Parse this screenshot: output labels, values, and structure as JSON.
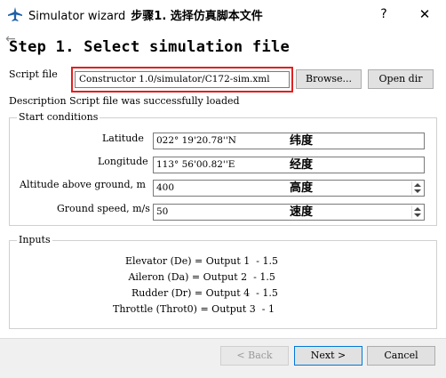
{
  "window": {
    "title": "Simulator wizard",
    "title_zh": "步骤1. 选择仿真脚本文件",
    "help_label": "?",
    "close_label": "✕"
  },
  "nav": {
    "back_arrow": "←"
  },
  "page": {
    "title": "Step 1. Select simulation file"
  },
  "script": {
    "label": "Script file",
    "path": "Constructor 1.0/simulator/C172-sim.xml",
    "browse_label": "Browse...",
    "open_dir_label": "Open dir"
  },
  "description": "Description Script file was successfully loaded",
  "start_conditions": {
    "title": "Start conditions",
    "latitude": {
      "label": "Latitude",
      "value": "022° 19'20.78''N",
      "zh": "纬度"
    },
    "longitude": {
      "label": "Longitude",
      "value": "113° 56'00.82''E",
      "zh": "经度"
    },
    "altitude": {
      "label": "Altitude above ground, m",
      "value": "400",
      "zh": "高度"
    },
    "speed": {
      "label": "Ground speed, m/s",
      "value": "50",
      "zh": "速度"
    }
  },
  "inputs": {
    "title": "Inputs",
    "rows": [
      "    Elevator (De) = Output 1  - 1.5",
      "     Aileron (Da) = Output 2  - 1.5",
      "      Rudder (Dr) = Output 4  - 1.5",
      "Throttle (Throt0) = Output 3  - 1"
    ]
  },
  "footer": {
    "back_label": "< Back",
    "next_label": "Next >",
    "cancel_label": "Cancel"
  },
  "icons": {
    "app": "airplane-icon"
  }
}
